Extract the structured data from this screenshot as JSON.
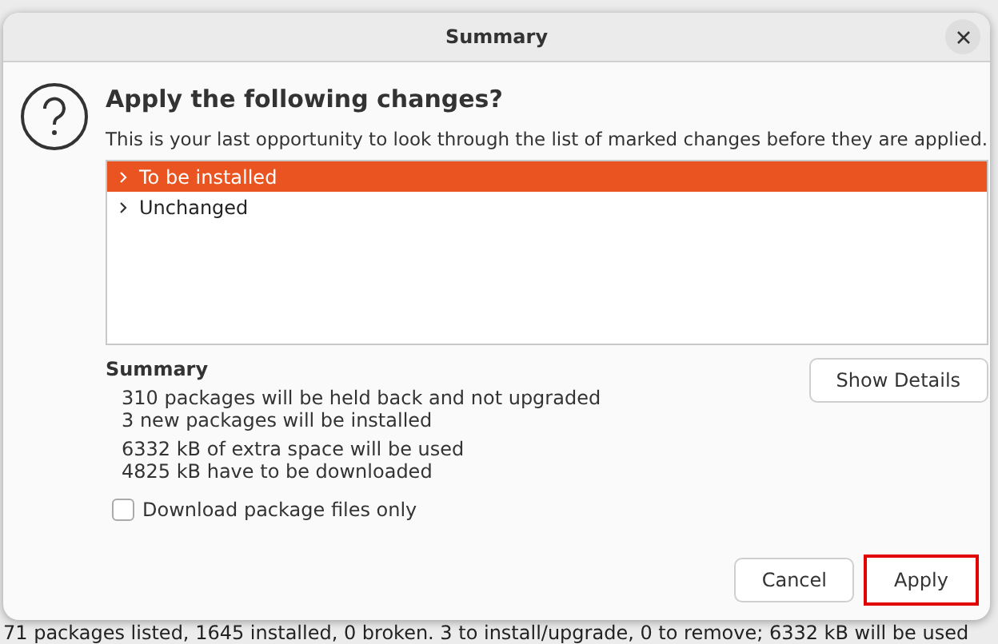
{
  "dialog": {
    "title": "Summary",
    "heading": "Apply the following changes?",
    "message": "This is your last opportunity to look through the list of marked changes before they are applied.",
    "changes": [
      {
        "label": "To be installed",
        "selected": true,
        "expanded": false
      },
      {
        "label": "Unchanged",
        "selected": false,
        "expanded": false
      }
    ],
    "summary": {
      "title": "Summary",
      "groups": [
        [
          "310 packages will be held back and not upgraded",
          "3 new packages will be installed"
        ],
        [
          "6332 kB of extra space will be used",
          "4825 kB have to be downloaded"
        ]
      ]
    },
    "show_details": "Show Details",
    "download_only": {
      "label": "Download package files only",
      "checked": false
    },
    "buttons": [
      {
        "label": "Cancel",
        "highlighted": false
      },
      {
        "label": "Apply",
        "highlighted": true
      }
    ]
  },
  "status_bar": "71 packages listed, 1645 installed, 0 broken. 3 to install/upgrade, 0 to remove; 6332 kB will be used"
}
